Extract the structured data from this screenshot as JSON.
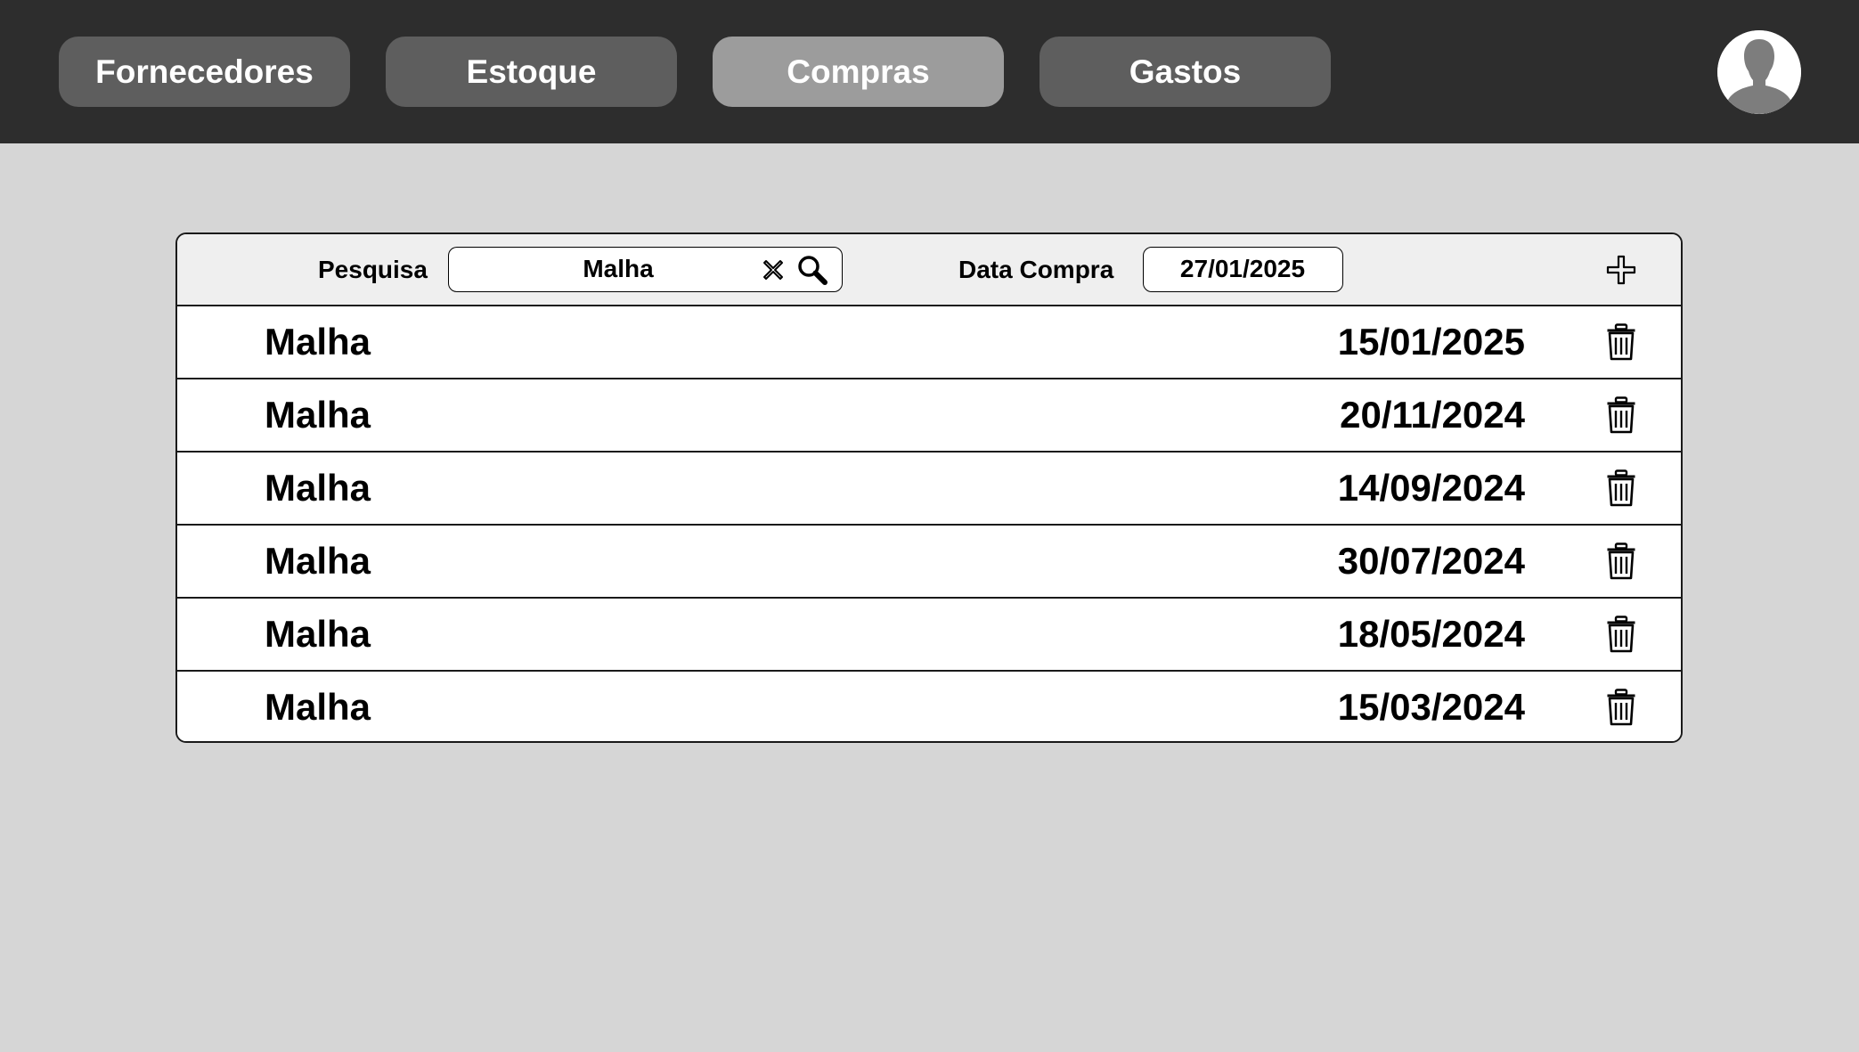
{
  "nav": {
    "tabs": [
      {
        "label": "Fornecedores",
        "active": false
      },
      {
        "label": "Estoque",
        "active": false
      },
      {
        "label": "Compras",
        "active": true
      },
      {
        "label": "Gastos",
        "active": false
      }
    ],
    "avatar_icon": "user-avatar-icon"
  },
  "toolbar": {
    "search_label": "Pesquisa",
    "search_value": "Malha",
    "clear_icon": "close-icon",
    "search_icon": "search-icon",
    "date_label": "Data Compra",
    "date_value": "27/01/2025",
    "add_icon": "plus-icon"
  },
  "rows": [
    {
      "name": "Malha",
      "date": "15/01/2025"
    },
    {
      "name": "Malha",
      "date": "20/11/2024"
    },
    {
      "name": "Malha",
      "date": "14/09/2024"
    },
    {
      "name": "Malha",
      "date": "30/07/2024"
    },
    {
      "name": "Malha",
      "date": "18/05/2024"
    },
    {
      "name": "Malha",
      "date": "15/03/2024"
    }
  ],
  "row_action_icon": "trash-icon",
  "colors": {
    "topbar": "#2d2d2d",
    "tab": "#5e5e5e",
    "tab_active": "#9c9c9c",
    "background": "#d6d6d6",
    "toolbar": "#efefef"
  }
}
